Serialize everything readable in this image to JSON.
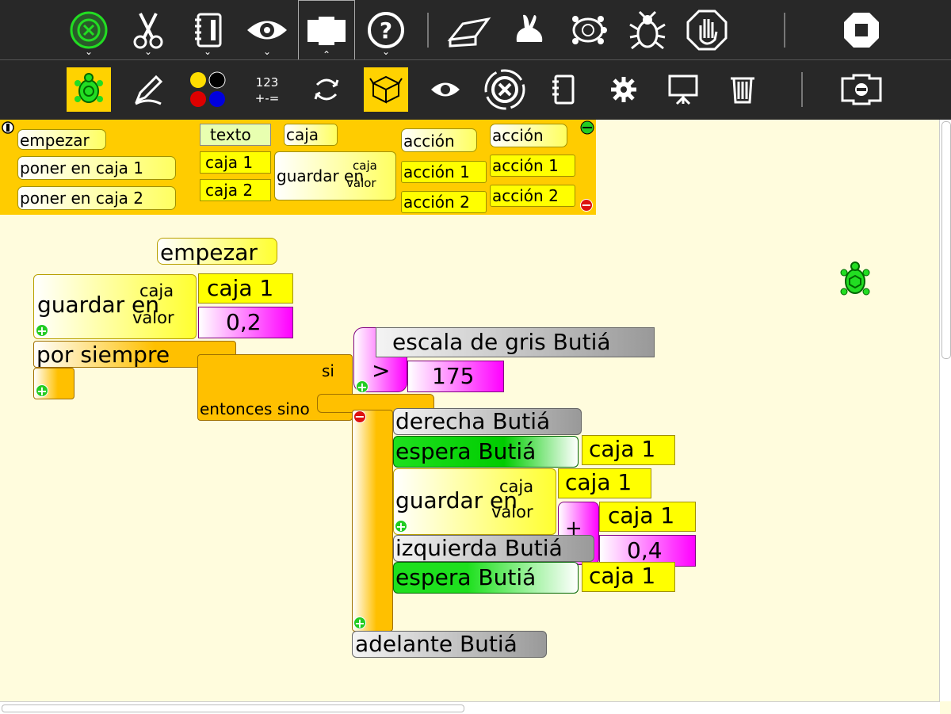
{
  "palette": {
    "col1": [
      "empezar",
      "poner en caja 1",
      "poner en caja 2"
    ],
    "col2": [
      "texto",
      "caja 1",
      "caja 2"
    ],
    "caja": "caja",
    "guardar_en": "guardar en",
    "caja_sock": "caja",
    "valor_sock": "valor",
    "col4": [
      "acción",
      "acción 1",
      "acción 2"
    ],
    "col5": [
      "acción",
      "acción 1",
      "acción 2"
    ]
  },
  "program": {
    "empezar": "empezar",
    "guardar_en": "guardar en",
    "caja_label": "caja",
    "valor_label": "valor",
    "caja1": "caja 1",
    "val02": "0,2",
    "por_siempre": "por siempre",
    "si": "si",
    "entonces_sino": "entonces sino",
    "gt": ">",
    "escala": "escala de gris Butiá",
    "v175": "175",
    "derecha": "derecha Butiá",
    "espera": "espera Butiá",
    "caja1b": "caja 1",
    "guardar_en2": "guardar en",
    "caja_label2": "caja",
    "valor_label2": "valor",
    "caja1c": "caja 1",
    "plus": "+",
    "caja1d": "caja 1",
    "izquierda": "izquierda Butiá",
    "val04": "0,4",
    "espera2": "espera Butiá",
    "caja1e": "caja 1",
    "adelante": "adelante Butiá"
  },
  "colors": {
    "toolbar": "#282828",
    "canvas": "#fffcdd",
    "selected": "#ffd200",
    "palette": "#ffcc00"
  },
  "icons": {
    "top": [
      "activity-icon",
      "cut-icon",
      "notebook-icon",
      "view-icon",
      "palette-toolbar-icon",
      "help-icon",
      "clean-icon",
      "fast-run-icon",
      "slow-run-icon",
      "debug-icon",
      "stop-icon",
      "stop-activity-icon"
    ],
    "sub": [
      "turtle-palette-icon",
      "pen-palette-icon",
      "colors-palette-icon",
      "numbers-palette-icon",
      "flow-palette-icon",
      "blocks-palette-icon",
      "sensors-palette-icon",
      "butia-palette-icon",
      "media-palette-icon",
      "extras-palette-icon",
      "portfolio-palette-icon",
      "trash-icon",
      "hide-palette-icon"
    ]
  }
}
